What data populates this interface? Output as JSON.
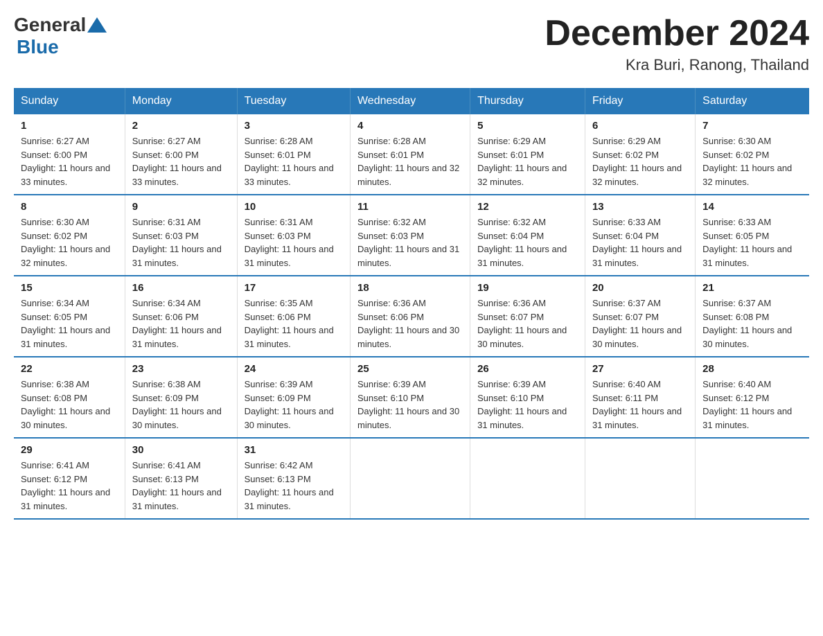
{
  "logo": {
    "general": "General",
    "blue": "Blue"
  },
  "title": "December 2024",
  "subtitle": "Kra Buri, Ranong, Thailand",
  "headers": [
    "Sunday",
    "Monday",
    "Tuesday",
    "Wednesday",
    "Thursday",
    "Friday",
    "Saturday"
  ],
  "weeks": [
    [
      {
        "day": "1",
        "sunrise": "6:27 AM",
        "sunset": "6:00 PM",
        "daylight": "11 hours and 33 minutes."
      },
      {
        "day": "2",
        "sunrise": "6:27 AM",
        "sunset": "6:00 PM",
        "daylight": "11 hours and 33 minutes."
      },
      {
        "day": "3",
        "sunrise": "6:28 AM",
        "sunset": "6:01 PM",
        "daylight": "11 hours and 33 minutes."
      },
      {
        "day": "4",
        "sunrise": "6:28 AM",
        "sunset": "6:01 PM",
        "daylight": "11 hours and 32 minutes."
      },
      {
        "day": "5",
        "sunrise": "6:29 AM",
        "sunset": "6:01 PM",
        "daylight": "11 hours and 32 minutes."
      },
      {
        "day": "6",
        "sunrise": "6:29 AM",
        "sunset": "6:02 PM",
        "daylight": "11 hours and 32 minutes."
      },
      {
        "day": "7",
        "sunrise": "6:30 AM",
        "sunset": "6:02 PM",
        "daylight": "11 hours and 32 minutes."
      }
    ],
    [
      {
        "day": "8",
        "sunrise": "6:30 AM",
        "sunset": "6:02 PM",
        "daylight": "11 hours and 32 minutes."
      },
      {
        "day": "9",
        "sunrise": "6:31 AM",
        "sunset": "6:03 PM",
        "daylight": "11 hours and 31 minutes."
      },
      {
        "day": "10",
        "sunrise": "6:31 AM",
        "sunset": "6:03 PM",
        "daylight": "11 hours and 31 minutes."
      },
      {
        "day": "11",
        "sunrise": "6:32 AM",
        "sunset": "6:03 PM",
        "daylight": "11 hours and 31 minutes."
      },
      {
        "day": "12",
        "sunrise": "6:32 AM",
        "sunset": "6:04 PM",
        "daylight": "11 hours and 31 minutes."
      },
      {
        "day": "13",
        "sunrise": "6:33 AM",
        "sunset": "6:04 PM",
        "daylight": "11 hours and 31 minutes."
      },
      {
        "day": "14",
        "sunrise": "6:33 AM",
        "sunset": "6:05 PM",
        "daylight": "11 hours and 31 minutes."
      }
    ],
    [
      {
        "day": "15",
        "sunrise": "6:34 AM",
        "sunset": "6:05 PM",
        "daylight": "11 hours and 31 minutes."
      },
      {
        "day": "16",
        "sunrise": "6:34 AM",
        "sunset": "6:06 PM",
        "daylight": "11 hours and 31 minutes."
      },
      {
        "day": "17",
        "sunrise": "6:35 AM",
        "sunset": "6:06 PM",
        "daylight": "11 hours and 31 minutes."
      },
      {
        "day": "18",
        "sunrise": "6:36 AM",
        "sunset": "6:06 PM",
        "daylight": "11 hours and 30 minutes."
      },
      {
        "day": "19",
        "sunrise": "6:36 AM",
        "sunset": "6:07 PM",
        "daylight": "11 hours and 30 minutes."
      },
      {
        "day": "20",
        "sunrise": "6:37 AM",
        "sunset": "6:07 PM",
        "daylight": "11 hours and 30 minutes."
      },
      {
        "day": "21",
        "sunrise": "6:37 AM",
        "sunset": "6:08 PM",
        "daylight": "11 hours and 30 minutes."
      }
    ],
    [
      {
        "day": "22",
        "sunrise": "6:38 AM",
        "sunset": "6:08 PM",
        "daylight": "11 hours and 30 minutes."
      },
      {
        "day": "23",
        "sunrise": "6:38 AM",
        "sunset": "6:09 PM",
        "daylight": "11 hours and 30 minutes."
      },
      {
        "day": "24",
        "sunrise": "6:39 AM",
        "sunset": "6:09 PM",
        "daylight": "11 hours and 30 minutes."
      },
      {
        "day": "25",
        "sunrise": "6:39 AM",
        "sunset": "6:10 PM",
        "daylight": "11 hours and 30 minutes."
      },
      {
        "day": "26",
        "sunrise": "6:39 AM",
        "sunset": "6:10 PM",
        "daylight": "11 hours and 31 minutes."
      },
      {
        "day": "27",
        "sunrise": "6:40 AM",
        "sunset": "6:11 PM",
        "daylight": "11 hours and 31 minutes."
      },
      {
        "day": "28",
        "sunrise": "6:40 AM",
        "sunset": "6:12 PM",
        "daylight": "11 hours and 31 minutes."
      }
    ],
    [
      {
        "day": "29",
        "sunrise": "6:41 AM",
        "sunset": "6:12 PM",
        "daylight": "11 hours and 31 minutes."
      },
      {
        "day": "30",
        "sunrise": "6:41 AM",
        "sunset": "6:13 PM",
        "daylight": "11 hours and 31 minutes."
      },
      {
        "day": "31",
        "sunrise": "6:42 AM",
        "sunset": "6:13 PM",
        "daylight": "11 hours and 31 minutes."
      },
      null,
      null,
      null,
      null
    ]
  ]
}
